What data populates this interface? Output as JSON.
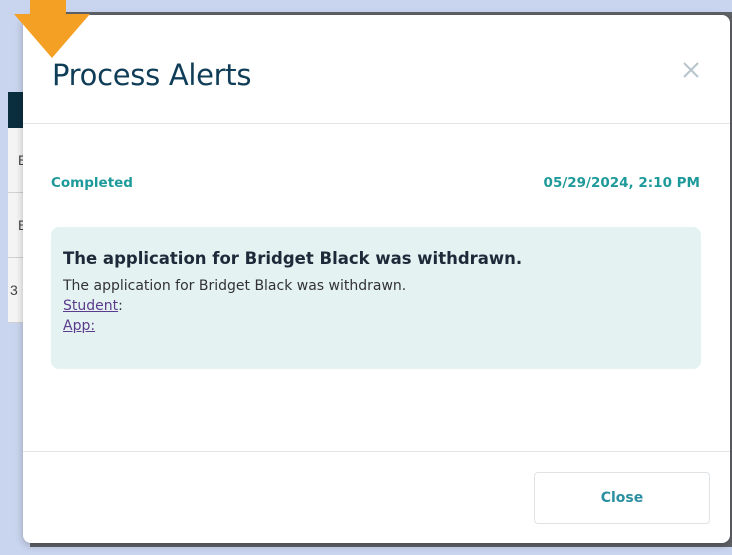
{
  "modal": {
    "title": "Process Alerts",
    "status": "Completed",
    "timestamp": "05/29/2024, 2:10 PM",
    "alert": {
      "heading": "The application for Bridget Black was withdrawn.",
      "body": "The application for Bridget Black was withdrawn.",
      "student_link": "Student",
      "student_suffix": ":",
      "app_link": "App:"
    },
    "close_button": "Close"
  },
  "background": {
    "row_chars": [
      "E",
      "E",
      "3"
    ]
  },
  "colors": {
    "title": "#0f3d57",
    "accent_teal": "#1f9a9a",
    "alert_bg": "#e4f2f2",
    "link": "#5b3b8c",
    "arrow": "#f4a024"
  },
  "icons": [
    "close-icon",
    "spotlight-arrow-icon"
  ]
}
